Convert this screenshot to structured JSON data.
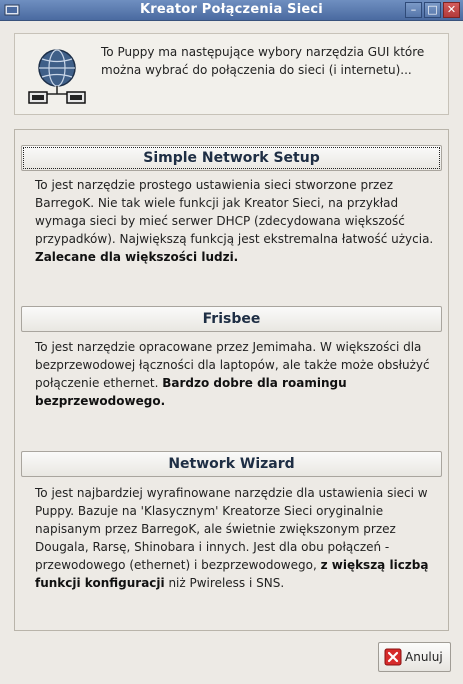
{
  "window": {
    "title": "Kreator Połączenia Sieci",
    "controls": {
      "minimize": "–",
      "maximize": "□",
      "close": "✕"
    }
  },
  "header": {
    "text": "To Puppy ma następujące wybory narzędzia GUI które można wybrać do połączenia do sieci (i internetu)..."
  },
  "options": [
    {
      "label": "Simple Network Setup",
      "desc_plain": "To jest narzędzie prostego ustawienia sieci stworzone przez BarregoK. Nie tak wiele funkcji jak Kreator Sieci, na przykład wymaga sieci by mieć serwer DHCP (zdecydowana większość przypadków). Największą funkcją jest ekstremalna łatwość użycia. ",
      "desc_bold": "Zalecane dla większości ludzi.",
      "desc_tail": ""
    },
    {
      "label": "Frisbee",
      "desc_plain": "To jest narzędzie opracowane przez Jemimaha. W większości dla bezprzewodowej łączności dla laptopów, ale także może obsłużyć połączenie ethernet. ",
      "desc_bold": "Bardzo dobre dla roamingu bezprzewodowego.",
      "desc_tail": ""
    },
    {
      "label": "Network Wizard",
      "desc_plain": "To jest najbardziej wyrafinowane narzędzie dla ustawienia sieci w Puppy. Bazuje na 'Klasycznym' Kreatorze Sieci oryginalnie napisanym przez BarregoK, ale świetnie zwiększonym przez Dougala, Rarsę, Shinobara i innych. Jest dla obu połączeń - przewodowego (ethernet) i bezprzewodowego, ",
      "desc_bold": "z większą liczbą funkcji konfiguracji",
      "desc_tail": " niż Pwireless i SNS."
    }
  ],
  "footer": {
    "cancel_label": "Anuluj",
    "cancel_icon": "cancel-x-icon"
  },
  "colors": {
    "titlebar": "#5a7ab0",
    "close": "#c04848",
    "window_bg": "#edeae5"
  }
}
